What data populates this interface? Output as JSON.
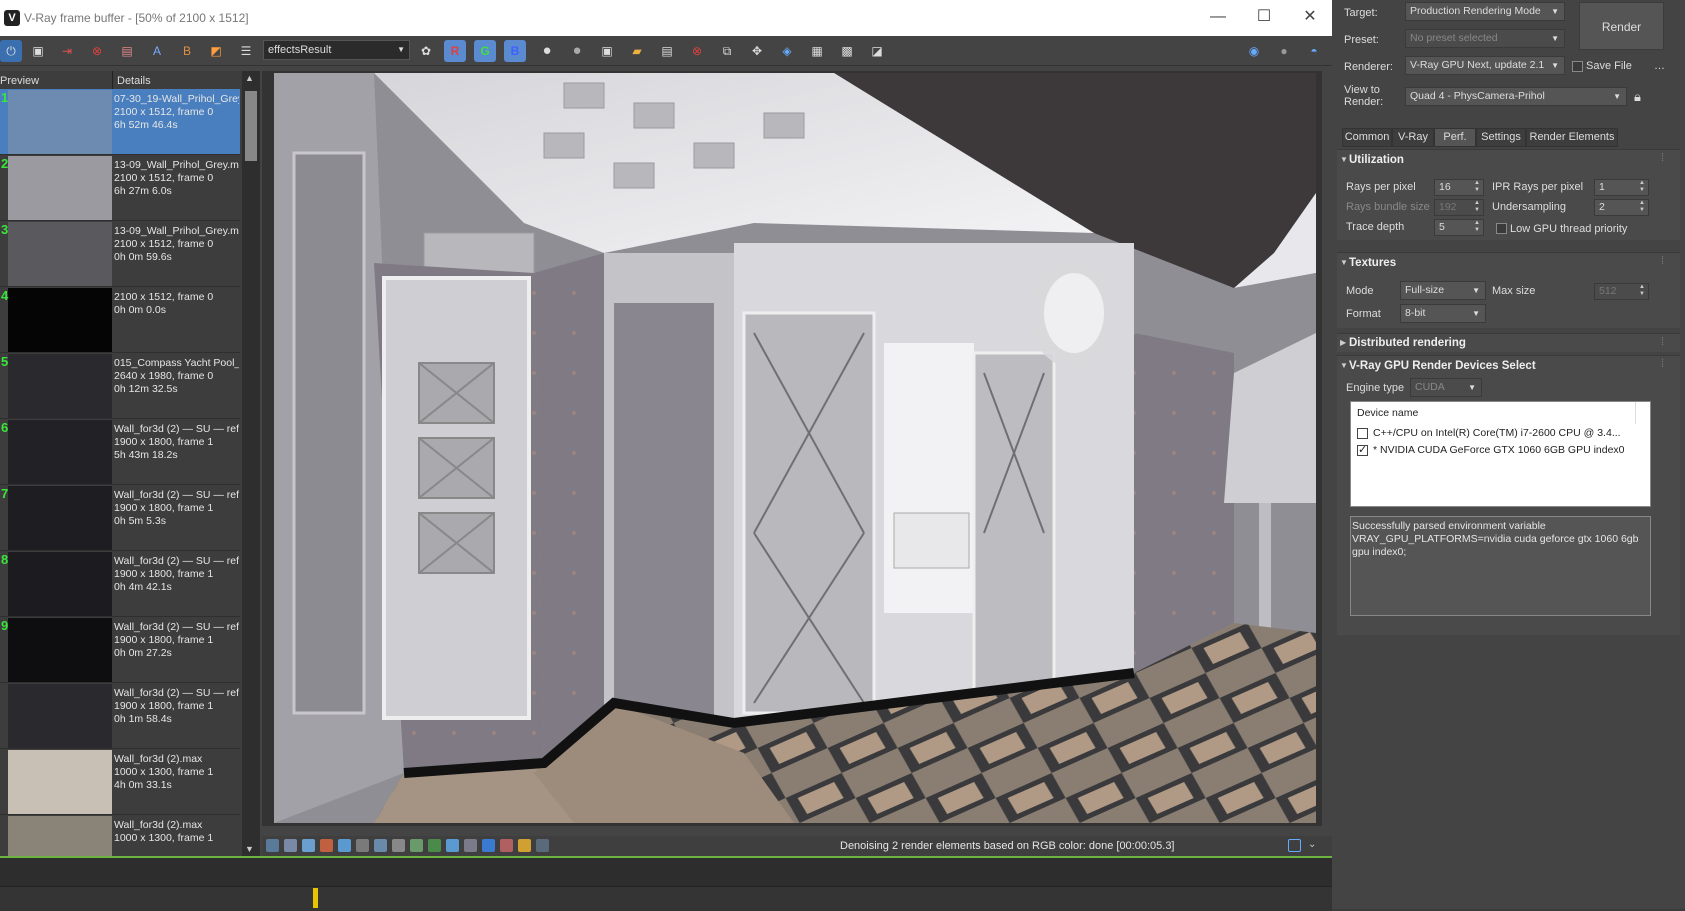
{
  "vfb": {
    "title": "V-Ray frame buffer - [50% of 2100 x 1512]",
    "channel": "effectsResult",
    "toolbar_icons": [
      "vray-logo-icon",
      "save-icon",
      "load-icon",
      "clear-icon",
      "rgb-channel-icon",
      "alpha-channel-icon",
      "mono-channel-icon",
      "color-correction-icon",
      "menu-icon"
    ],
    "channel_letters": {
      "r": "R",
      "g": "G",
      "b": "B"
    },
    "history_headers": {
      "preview": "Preview",
      "details": "Details"
    },
    "history": [
      {
        "num": "1",
        "lines": [
          "07-30_19-Wall_Prihol_Grey",
          "2100 x 1512, frame 0",
          "6h 52m 46.4s"
        ],
        "selected": true
      },
      {
        "num": "2",
        "lines": [
          "13-09_Wall_Prihol_Grey.m",
          "2100 x 1512, frame 0",
          "6h 27m 6.0s"
        ]
      },
      {
        "num": "3",
        "lines": [
          "13-09_Wall_Prihol_Grey.m",
          "2100 x 1512, frame 0",
          "0h 0m 59.6s"
        ]
      },
      {
        "num": "4",
        "lines": [
          "2100 x 1512, frame 0",
          "0h 0m 0.0s"
        ]
      },
      {
        "num": "5",
        "lines": [
          "015_Compass Yacht Pool_",
          "2640 x 1980, frame 0",
          "0h 12m 32.5s"
        ]
      },
      {
        "num": "6",
        "lines": [
          "Wall_for3d (2) — SU — ref",
          "1900 x 1800, frame 1",
          "5h 43m 18.2s"
        ]
      },
      {
        "num": "7",
        "lines": [
          "Wall_for3d (2) — SU — ref",
          "1900 x 1800, frame 1",
          "0h 5m 5.3s"
        ]
      },
      {
        "num": "8",
        "lines": [
          "Wall_for3d (2) — SU — ref",
          "1900 x 1800, frame 1",
          "0h 4m 42.1s"
        ]
      },
      {
        "num": "9",
        "lines": [
          "Wall_for3d (2) — SU — ref",
          "1900 x 1800, frame 1",
          "0h 0m 27.2s"
        ]
      },
      {
        "num": "",
        "lines": [
          "Wall_for3d (2) — SU — ref",
          "1900 x 1800, frame 1",
          "0h 1m 58.4s"
        ]
      },
      {
        "num": "",
        "lines": [
          "Wall_for3d (2).max",
          "1000 x 1300, frame 1",
          "4h 0m 33.1s"
        ]
      },
      {
        "num": "",
        "lines": [
          "Wall_for3d (2).max",
          "1000 x 1300, frame 1"
        ]
      }
    ],
    "status": "Denoising 2 render elements based on RGB color: done [00:00:05.3]"
  },
  "render_setup": {
    "target_label": "Target:",
    "target_value": "Production Rendering Mode",
    "preset_label": "Preset:",
    "preset_value": "No preset selected",
    "renderer_label": "Renderer:",
    "renderer_value": "V-Ray GPU Next, update 2.1",
    "save_file": "Save File",
    "view_label_1": "View to",
    "view_label_2": "Render:",
    "view_value": "Quad 4 - PhysCamera-Prihol",
    "render_button": "Render",
    "tabs": [
      "Common",
      "V-Ray",
      "Perf.",
      "Settings",
      "Render Elements"
    ],
    "active_tab": "Perf.",
    "utilization": {
      "title": "Utilization",
      "rays_per_pixel_label": "Rays per pixel",
      "rays_per_pixel": "16",
      "ipr_rays_label": "IPR Rays per pixel",
      "ipr_rays": "1",
      "bundle_label": "Rays bundle size",
      "bundle": "192",
      "undersampling_label": "Undersampling",
      "undersampling": "2",
      "trace_depth_label": "Trace depth",
      "trace_depth": "5",
      "low_gpu_label": "Low GPU thread priority"
    },
    "textures": {
      "title": "Textures",
      "mode_label": "Mode",
      "mode": "Full-size",
      "max_size_label": "Max size",
      "max_size": "512",
      "format_label": "Format",
      "format": "8-bit"
    },
    "distributed": {
      "title": "Distributed rendering"
    },
    "devices": {
      "title": "V-Ray GPU Render Devices Select",
      "engine_label": "Engine type",
      "engine": "CUDA",
      "device_header": "Device name",
      "device_1": "C++/CPU on Intel(R) Core(TM) i7-2600 CPU @ 3.4...",
      "device_2": "* NVIDIA CUDA GeForce GTX 1060 6GB GPU index0",
      "message": "Successfully parsed environment variable VRAY_GPU_PLATFORMS=nvidia cuda geforce gtx 1060 6gb gpu index0;"
    }
  }
}
